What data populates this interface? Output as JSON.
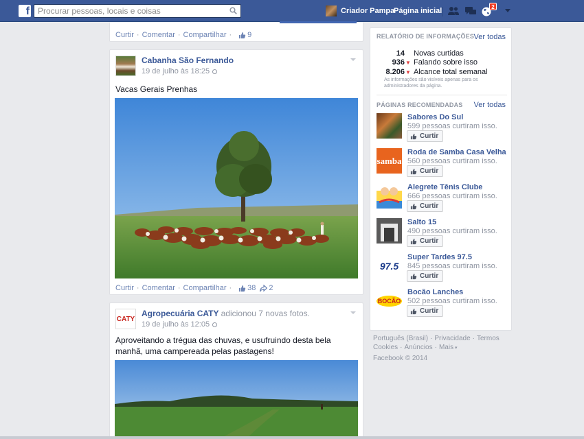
{
  "topbar": {
    "search_placeholder": "Procurar pessoas, locais e coisas",
    "profile_name": "Criador Pampa",
    "home_label": "Página inicial",
    "notification_count": "2"
  },
  "post0": {
    "actions": {
      "like": "Curtir",
      "comment": "Comentar",
      "share": "Compartilhar",
      "likes": "9"
    }
  },
  "post1": {
    "author": "Cabanha São Fernando",
    "time": "19 de julho às 18:25",
    "text": "Vacas Gerais Prenhas",
    "actions": {
      "like": "Curtir",
      "comment": "Comentar",
      "share": "Compartilhar",
      "likes": "38",
      "shares": "2"
    }
  },
  "post2": {
    "author": "Agropecuária CATY",
    "activity": "adicionou 7 novas fotos.",
    "avatar_text": "CATY",
    "time": "19 de julho às 12:05",
    "text": "Aproveitando a trégua das chuvas, e usufruindo desta bela manhã, uma campereada pelas pastagens!"
  },
  "insights": {
    "title": "RELATÓRIO DE INFORMAÇÕES",
    "see_all": "Ver todas",
    "stats": [
      {
        "num": "14",
        "label": "Novas curtidas",
        "arrow": ""
      },
      {
        "num": "936",
        "label": "Falando sobre isso",
        "arrow": "▼"
      },
      {
        "num": "8.206",
        "label": "Alcance total semanal",
        "arrow": "▼"
      }
    ],
    "note": "As informações são visíveis apenas para os administradores da página."
  },
  "recommended": {
    "title": "PÁGINAS RECOMENDADAS",
    "see_all": "Ver todas",
    "like_label": "Curtir",
    "pages": [
      {
        "name": "Sabores Do Sul",
        "count": "599 pessoas curtiram isso."
      },
      {
        "name": "Roda de Samba Casa Velha",
        "count": "560 pessoas curtiram isso.",
        "thumb_text": "samba"
      },
      {
        "name": "Alegrete Tênis Clube",
        "count": "666 pessoas curtiram isso."
      },
      {
        "name": "Salto 15",
        "count": "490 pessoas curtiram isso."
      },
      {
        "name": "Super Tardes 97.5",
        "count": "845 pessoas curtiram isso.",
        "thumb_text": "97.5"
      },
      {
        "name": "Bocão Lanches",
        "count": "502 pessoas curtiram isso.",
        "thumb_text": "BOCÃO"
      }
    ]
  },
  "footer": {
    "language": "Português (Brasil)",
    "privacy": "Privacidade",
    "terms": "Termos",
    "cookies": "Cookies",
    "ads": "Anúncios",
    "more": "Mais",
    "copyright": "Facebook © 2014"
  }
}
